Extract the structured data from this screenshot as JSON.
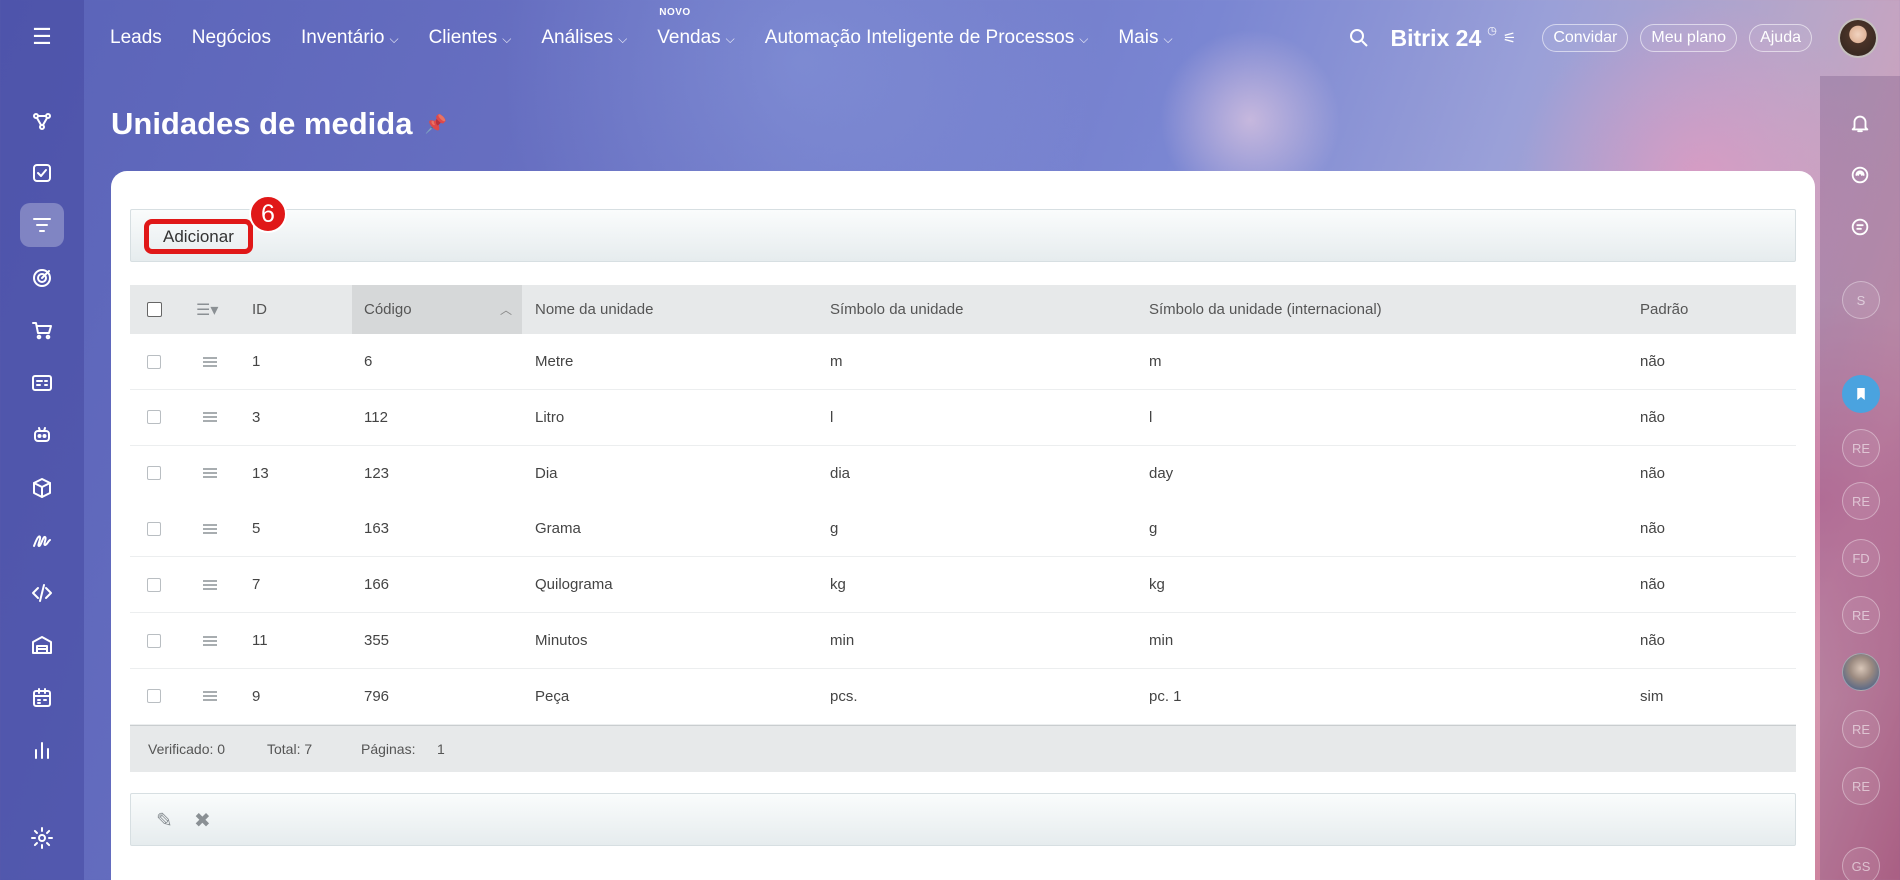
{
  "top_menu": [
    {
      "label": "Leads",
      "has_dropdown": false
    },
    {
      "label": "Negócios",
      "has_dropdown": false
    },
    {
      "label": "Inventário",
      "has_dropdown": true
    },
    {
      "label": "Clientes",
      "has_dropdown": true
    },
    {
      "label": "Análises",
      "has_dropdown": true
    },
    {
      "label": "Vendas",
      "has_dropdown": true,
      "badge": "NOVO"
    },
    {
      "label": "Automação Inteligente de Processos",
      "has_dropdown": true
    },
    {
      "label": "Mais",
      "has_dropdown": true
    }
  ],
  "header": {
    "brand": "Bitrix 24",
    "invite_label": "Convidar",
    "plan_label": "Meu plano",
    "help_label": "Ajuda"
  },
  "page": {
    "title": "Unidades de medida"
  },
  "toolbar": {
    "add_label": "Adicionar",
    "step_number": "6"
  },
  "table": {
    "columns": [
      "ID",
      "Código",
      "Nome da unidade",
      "Símbolo da unidade",
      "Símbolo da unidade (internacional)",
      "Padrão"
    ],
    "sorted_column": "Código",
    "rows": [
      {
        "id": "1",
        "code": "6",
        "name": "Metre",
        "symbol": "m",
        "symbol_intl": "m",
        "default": "não"
      },
      {
        "id": "3",
        "code": "112",
        "name": "Litro",
        "symbol": "l",
        "symbol_intl": "l",
        "default": "não"
      },
      {
        "id": "13",
        "code": "123",
        "name": "Dia",
        "symbol": "dia",
        "symbol_intl": "day",
        "default": "não"
      },
      {
        "id": "5",
        "code": "163",
        "name": "Grama",
        "symbol": "g",
        "symbol_intl": "g",
        "default": "não"
      },
      {
        "id": "7",
        "code": "166",
        "name": "Quilograma",
        "symbol": "kg",
        "symbol_intl": "kg",
        "default": "não"
      },
      {
        "id": "11",
        "code": "355",
        "name": "Minutos",
        "symbol": "min",
        "symbol_intl": "min",
        "default": "não"
      },
      {
        "id": "9",
        "code": "796",
        "name": "Peça",
        "symbol": "pcs.",
        "symbol_intl": "pc. 1",
        "default": "sim"
      }
    ]
  },
  "footer": {
    "checked_label": "Verificado: 0",
    "total_label": "Total: 7",
    "pages_label": "Páginas:",
    "pages_value": "1"
  },
  "right_avatars": [
    "S",
    "RE",
    "RE",
    "FD",
    "RE",
    "RE",
    "RE",
    "GS"
  ],
  "colors": {
    "highlight_red": "#e01818",
    "bookmark_blue": "#4aa3df"
  }
}
